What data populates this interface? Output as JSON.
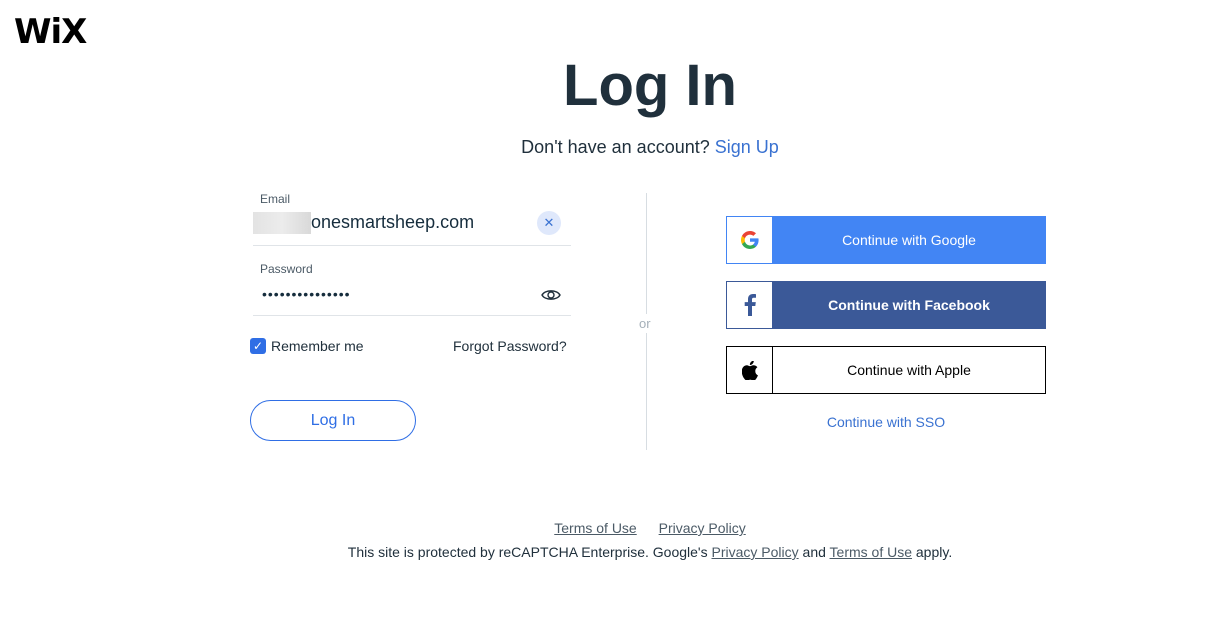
{
  "brand": {
    "logo_text": "WiX"
  },
  "header": {
    "title": "Log In",
    "signup_prompt": "Don't have an account?",
    "signup_link": "Sign Up"
  },
  "form": {
    "email_label": "Email",
    "email_value": "onesmartsheep.com",
    "password_label": "Password",
    "password_value": "•••••••••••••••",
    "remember_label": "Remember me",
    "remember_checked": true,
    "forgot_label": "Forgot Password?",
    "login_button": "Log In"
  },
  "divider": {
    "or_text": "or"
  },
  "social": {
    "google_label": "Continue with Google",
    "facebook_label": "Continue with Facebook",
    "apple_label": "Continue with Apple",
    "sso_label": "Continue with SSO"
  },
  "footer": {
    "terms_link": "Terms of Use",
    "privacy_link": "Privacy Policy",
    "recaptcha_prefix": "This site is protected by reCAPTCHA Enterprise. Google's",
    "recaptcha_privacy": "Privacy Policy",
    "recaptcha_and": "and",
    "recaptcha_terms": "Terms of Use",
    "recaptcha_suffix": "apply."
  },
  "colors": {
    "accent": "#2f6ee5",
    "google": "#4285f4",
    "facebook": "#3b5998",
    "text": "#20303c"
  }
}
